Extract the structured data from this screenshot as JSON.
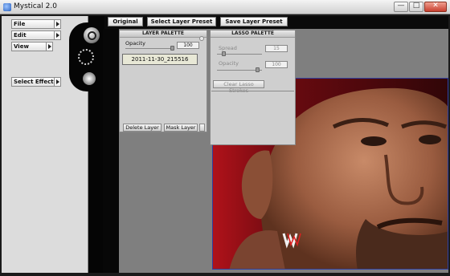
{
  "window": {
    "title": "Mystical 2.0",
    "controls": {
      "minimize": "—",
      "maximize": "□",
      "close": "✕"
    }
  },
  "menu": {
    "items": [
      {
        "label": "File"
      },
      {
        "label": "Edit"
      },
      {
        "label": "View"
      },
      {
        "label": "Select Effect"
      }
    ]
  },
  "tools": [
    "zoom-icon",
    "lasso-icon",
    "hand-icon"
  ],
  "toolbar": {
    "original_label": "Original",
    "select_preset_label": "Select Layer Preset",
    "save_preset_label": "Save Layer Preset"
  },
  "layer_palette": {
    "title": "LAYER PALETTE",
    "opacity_label": "Opacity",
    "opacity_value": "100",
    "layers": [
      "2011-11-30_215516"
    ],
    "delete_label": "Delete Layer",
    "mask_label": "Mask Layer"
  },
  "lasso_palette": {
    "title": "LASSO PALETTE",
    "spread_label": "Spread",
    "spread_value": "15",
    "opacity_label": "Opacity",
    "opacity_value": "100",
    "clear_label": "Clear Lasso Strokes"
  },
  "colors": {
    "background": "#1a1a1a",
    "workspace": "#7f7f7f",
    "panel": "#cfcfcf",
    "photo_bg": "#a01418"
  }
}
